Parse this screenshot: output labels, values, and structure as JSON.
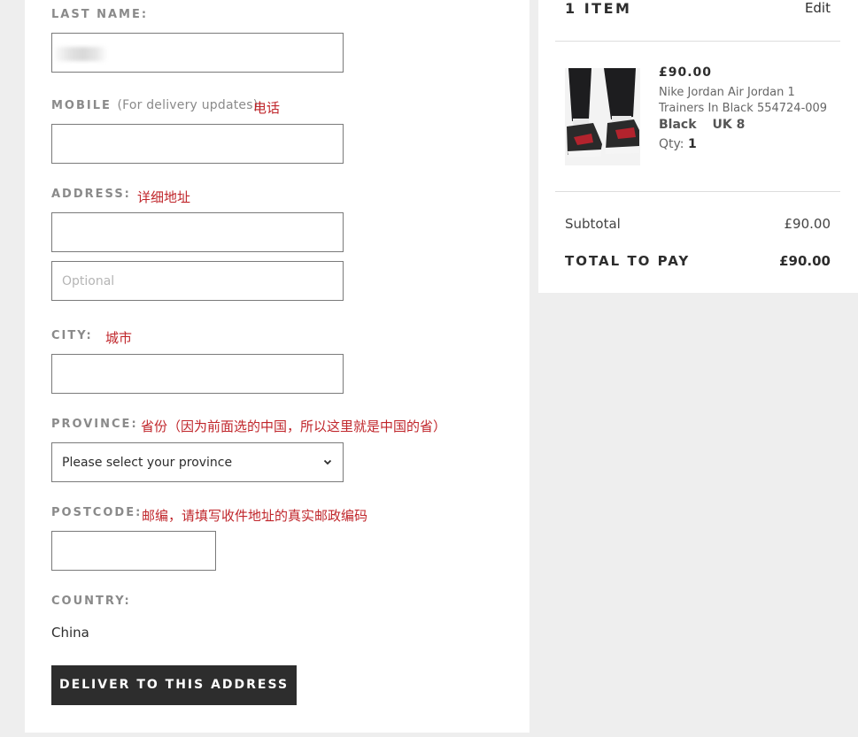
{
  "form": {
    "last_name": {
      "label": "LAST NAME:",
      "value": ""
    },
    "mobile": {
      "label": "MOBILE",
      "sublabel": "(For delivery updates):",
      "annotation": "电话",
      "value": ""
    },
    "address": {
      "label": "ADDRESS:",
      "annotation": "详细地址",
      "line1_value": "",
      "line2_placeholder": "Optional"
    },
    "city": {
      "label": "CITY:",
      "annotation": "城市",
      "value": ""
    },
    "province": {
      "label": "PROVINCE:",
      "annotation": "省份（因为前面选的中国，所以这里就是中国的省）",
      "selected": "Please select your province"
    },
    "postcode": {
      "label": "POSTCODE:",
      "annotation": "邮编，请填写收件地址的真实邮政编码",
      "value": ""
    },
    "country": {
      "label": "COUNTRY:",
      "value": "China"
    },
    "submit_label": "DELIVER TO THIS ADDRESS"
  },
  "summary": {
    "items_title": "1 ITEM",
    "edit_label": "Edit",
    "item": {
      "price": "£90.00",
      "name": "Nike Jordan Air Jordan 1 Trainers In Black 554724-009",
      "color": "Black",
      "size": "UK 8",
      "qty_label": "Qty:",
      "qty": "1",
      "image": "black-red-sneaker-photo"
    },
    "subtotal_label": "Subtotal",
    "subtotal_value": "£90.00",
    "total_label": "TOTAL TO PAY",
    "total_value": "£90.00"
  },
  "colors": {
    "annotation_red": "#c0262b",
    "button_dark": "#2d2d2d",
    "page_bg": "#eeeeee"
  }
}
